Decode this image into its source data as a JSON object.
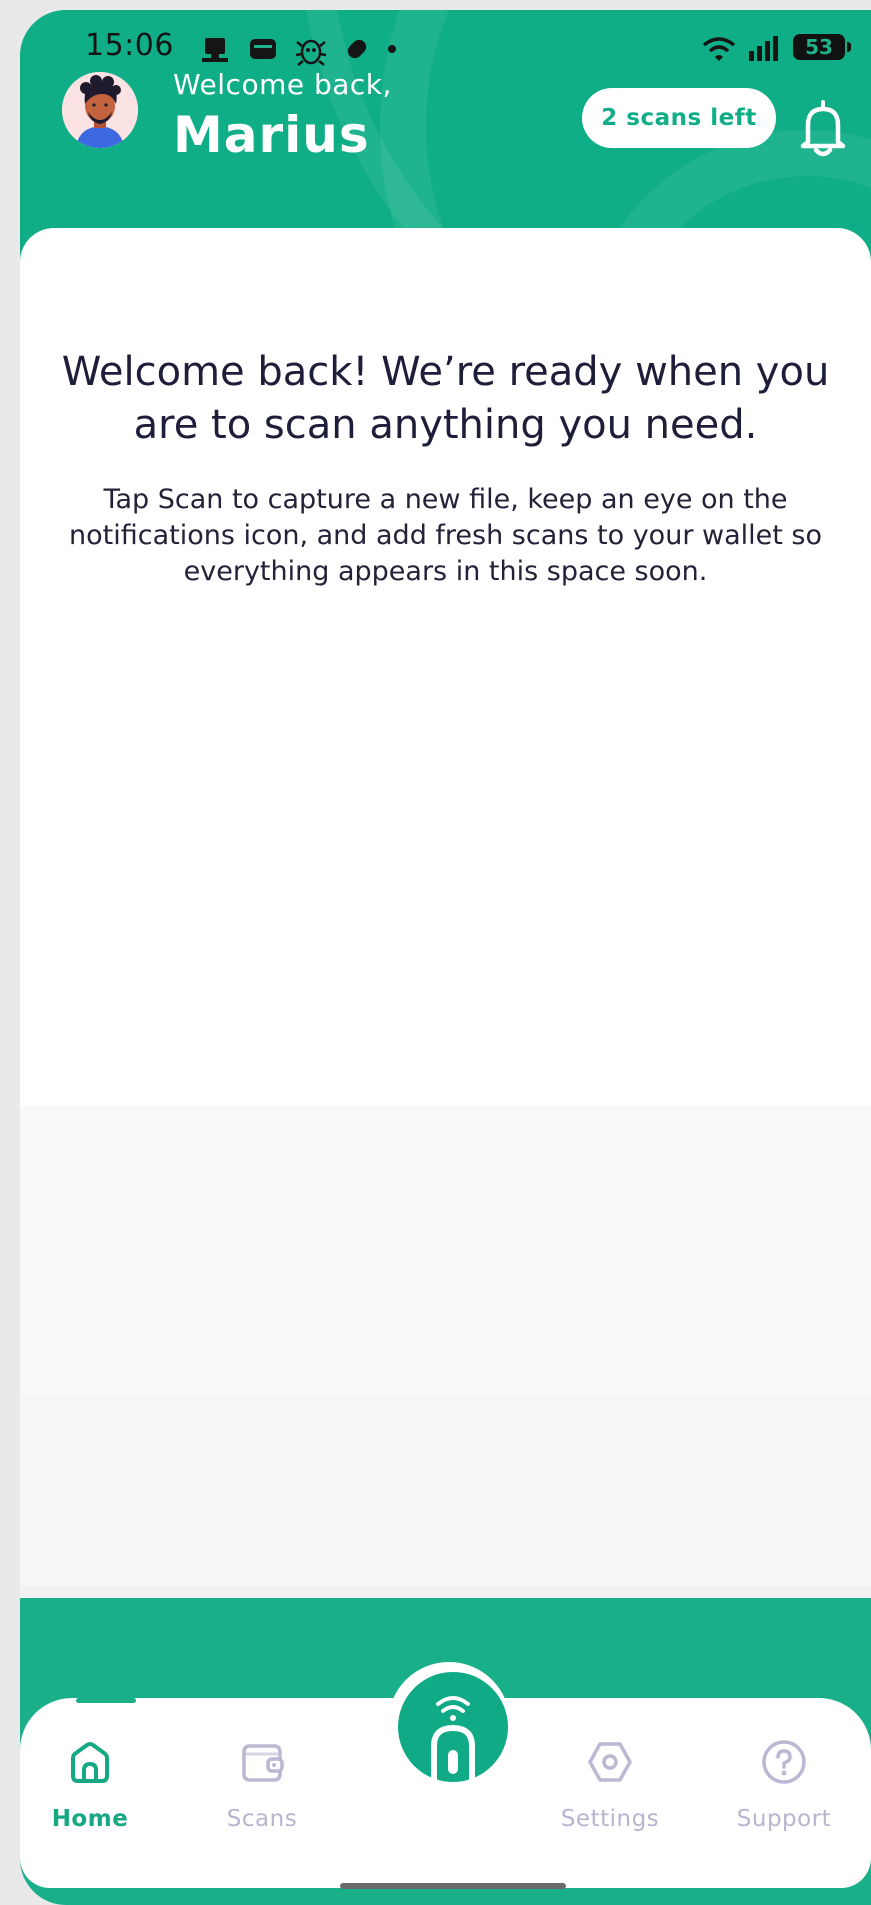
{
  "colors": {
    "brand": "#0fae87",
    "heading_text": "#1e1d3a",
    "inactive_nav": "#b8b4d0"
  },
  "status_bar": {
    "time": "15:06",
    "battery": "53",
    "icons": [
      "device-icon",
      "wallet-icon",
      "bug-icon",
      "tag-icon",
      "dot-icon",
      "wifi-icon",
      "signal-icon",
      "battery-icon"
    ]
  },
  "header": {
    "greeting": "Welcome back,",
    "username": "Marius",
    "scans_left_label": "2 scans left"
  },
  "main": {
    "headline": "Welcome back! We’re ready when you are to scan anything you need.",
    "subtext": "Tap Scan to capture a new file, keep an eye on the notifications icon, and add fresh scans to your wallet so everything appears in this space soon."
  },
  "bottom_nav": {
    "active": "Home",
    "items": [
      {
        "label": "Home",
        "icon": "home-icon"
      },
      {
        "label": "Scans",
        "icon": "wallet-icon"
      },
      {
        "label": "Settings",
        "icon": "settings-icon"
      },
      {
        "label": "Support",
        "icon": "help-icon"
      }
    ],
    "scan_button_icon": "nfc-scan-icon"
  }
}
